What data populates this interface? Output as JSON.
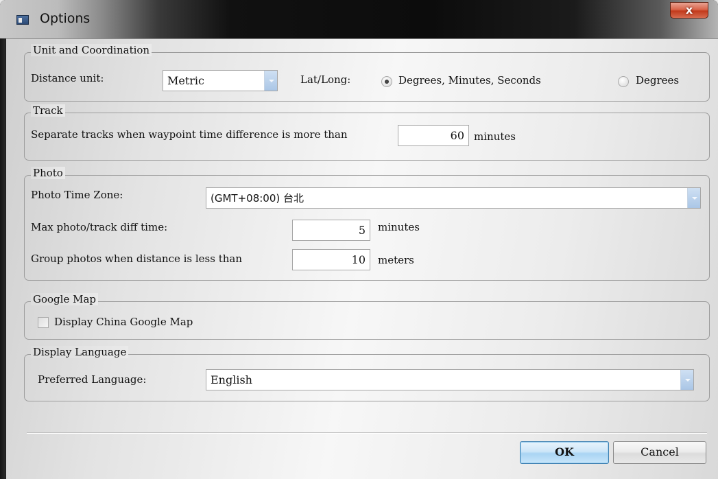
{
  "window": {
    "title": "Options",
    "close_label": "x"
  },
  "unit_group": {
    "legend": "Unit and Coordination",
    "distance_label": "Distance unit:",
    "distance_value": "Metric",
    "latlong_label": "Lat/Long:",
    "option_dms": "Degrees, Minutes, Seconds",
    "option_deg": "Degrees",
    "selected": "Degrees, Minutes, Seconds"
  },
  "track_group": {
    "legend": "Track",
    "separate_label": "Separate tracks when waypoint time difference is more than",
    "separate_value": "60",
    "separate_unit": "minutes"
  },
  "photo_group": {
    "legend": "Photo",
    "timezone_label": "Photo Time Zone:",
    "timezone_value": "(GMT+08:00) 台北",
    "maxdiff_label": "Max photo/track diff time:",
    "maxdiff_value": "5",
    "maxdiff_unit": "minutes",
    "group_label": "Group photos when distance is less than",
    "group_value": "10",
    "group_unit": "meters"
  },
  "google_group": {
    "legend": "Google Map",
    "china_map_label": "Display China Google Map",
    "china_map_checked": false
  },
  "language_group": {
    "legend": "Display Language",
    "preferred_label": "Preferred Language:",
    "preferred_value": "English"
  },
  "buttons": {
    "ok": "OK",
    "cancel": "Cancel"
  },
  "colors": {
    "accent": "#a9d4f3",
    "close": "#c23a1c"
  }
}
